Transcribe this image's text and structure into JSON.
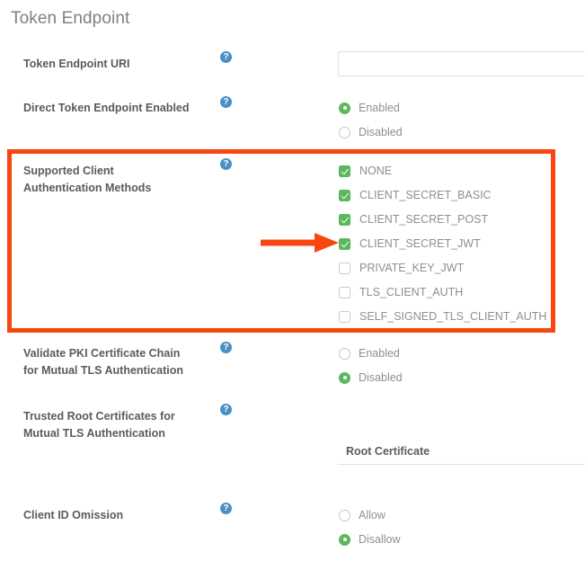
{
  "section": {
    "title": "Token Endpoint"
  },
  "help_icon_glyph": "?",
  "colors": {
    "accent_green": "#5cb85c",
    "help_blue": "#4a90c4",
    "annotation_red": "#f9460f",
    "label_gray": "#555c62",
    "value_gray": "#8a9096"
  },
  "fields": [
    {
      "key": "token_endpoint_uri",
      "label": "Token Endpoint URI",
      "type": "text",
      "value": "",
      "placeholder": ""
    },
    {
      "key": "direct_token_endpoint_enabled",
      "label": "Direct Token Endpoint Enabled",
      "type": "radio",
      "options": [
        {
          "label": "Enabled",
          "selected": true
        },
        {
          "label": "Disabled",
          "selected": false
        }
      ]
    },
    {
      "key": "supported_client_authentication_methods",
      "label": "Supported Client Authentication Methods",
      "label_line1": "Supported Client",
      "label_line2": "Authentication Methods",
      "type": "checkbox",
      "options": [
        {
          "label": "NONE",
          "checked": true
        },
        {
          "label": "CLIENT_SECRET_BASIC",
          "checked": true
        },
        {
          "label": "CLIENT_SECRET_POST",
          "checked": true
        },
        {
          "label": "CLIENT_SECRET_JWT",
          "checked": true
        },
        {
          "label": "PRIVATE_KEY_JWT",
          "checked": false
        },
        {
          "label": "TLS_CLIENT_AUTH",
          "checked": false
        },
        {
          "label": "SELF_SIGNED_TLS_CLIENT_AUTH",
          "checked": false
        }
      ]
    },
    {
      "key": "validate_pki_certificate_chain",
      "label": "Validate PKI Certificate Chain for Mutual TLS Authentication",
      "label_line1": "Validate PKI Certificate Chain",
      "label_line2": "for Mutual TLS Authentication",
      "type": "radio",
      "options": [
        {
          "label": "Enabled",
          "selected": false
        },
        {
          "label": "Disabled",
          "selected": true
        }
      ]
    },
    {
      "key": "trusted_root_certificates",
      "label": "Trusted Root Certificates for Mutual TLS Authentication",
      "label_line1": "Trusted Root Certificates for",
      "label_line2": "Mutual TLS Authentication",
      "type": "table",
      "column_header": "Root Certificate"
    },
    {
      "key": "client_id_omission",
      "label": "Client ID Omission",
      "type": "radio",
      "options": [
        {
          "label": "Allow",
          "selected": false
        },
        {
          "label": "Disallow",
          "selected": true
        }
      ]
    }
  ],
  "annotations": {
    "highlight_box": {
      "name": "supported-client-authentication-methods-highlight"
    },
    "arrow": {
      "name": "arrow-pointing-to-client-secret-jwt",
      "points_to": "CLIENT_SECRET_JWT"
    }
  }
}
